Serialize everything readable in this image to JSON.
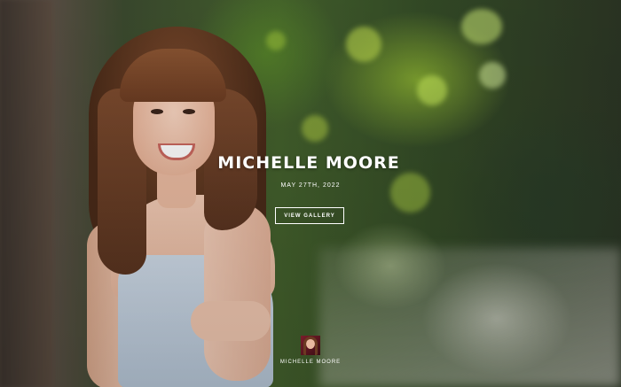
{
  "hero": {
    "title": "MICHELLE MOORE",
    "date": "MAY 27TH, 2022",
    "button_label": "VIEW GALLERY"
  },
  "footer_logo": {
    "name": "MICHELLE MOORE",
    "icon": "profile-thumbnail-icon"
  },
  "colors": {
    "text": "#ffffff",
    "thumbnail_bg": "#7a1d2a"
  }
}
